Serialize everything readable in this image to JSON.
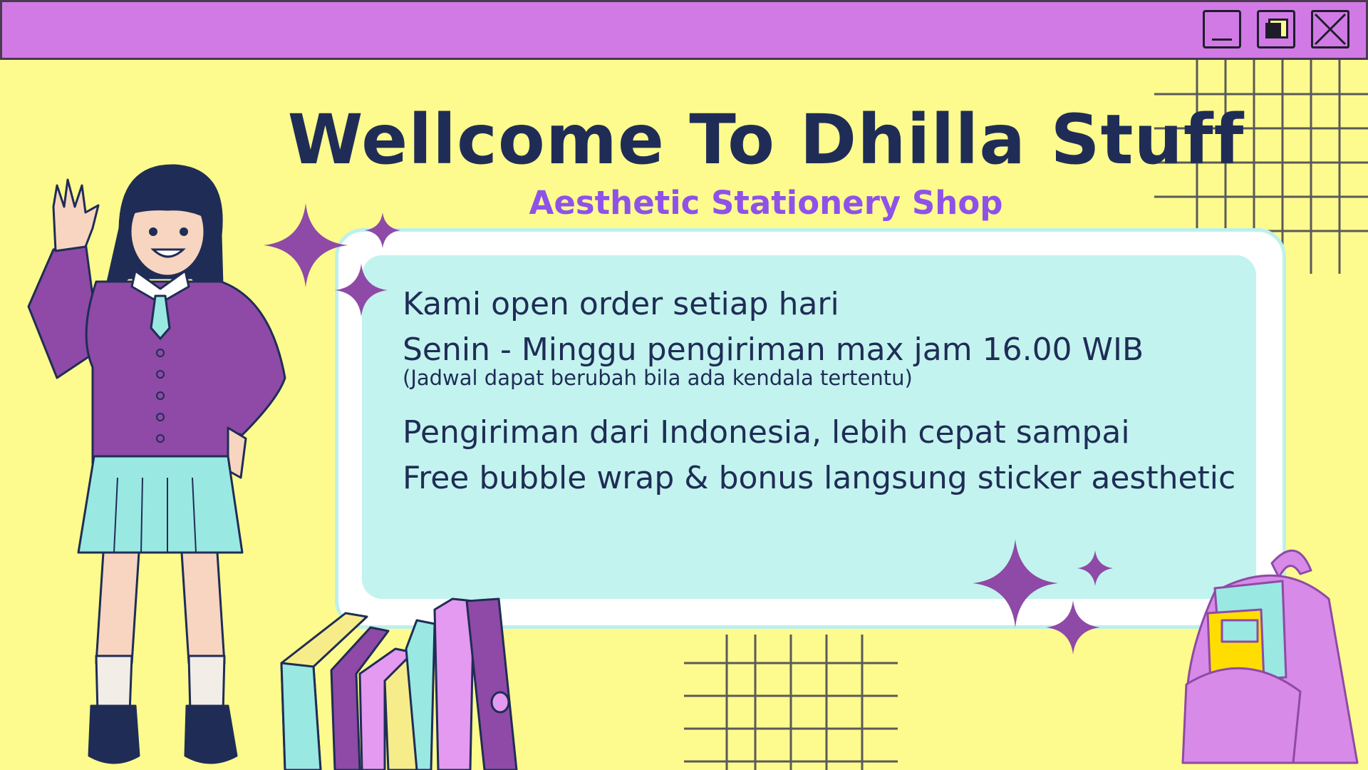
{
  "window": {
    "controls": [
      {
        "name": "minimize-icon"
      },
      {
        "name": "maximize-icon"
      },
      {
        "name": "close-icon"
      }
    ]
  },
  "header": {
    "title": "Wellcome To Dhilla Stuff",
    "subtitle": "Aesthetic Stationery Shop"
  },
  "info": {
    "line1": "Kami open order setiap hari",
    "line2": "Senin - Minggu pengiriman max jam 16.00 WIB",
    "note": "(Jadwal dapat berubah bila ada kendala tertentu)",
    "line3": "Pengiriman dari Indonesia, lebih cepat sampai",
    "line4": "Free bubble wrap & bonus langsung sticker aesthetic"
  },
  "colors": {
    "background": "#fdfb8e",
    "titlebar": "#d17ae6",
    "title_text": "#1f2d56",
    "subtitle_text": "#8e52e8",
    "panel": "#c3f3ef",
    "sparkle": "#8e4aa6"
  },
  "illustrations": [
    "waving-girl-illustration",
    "book-stack-illustration",
    "backpack-illustration",
    "sparkle-icon",
    "grid-decoration"
  ]
}
